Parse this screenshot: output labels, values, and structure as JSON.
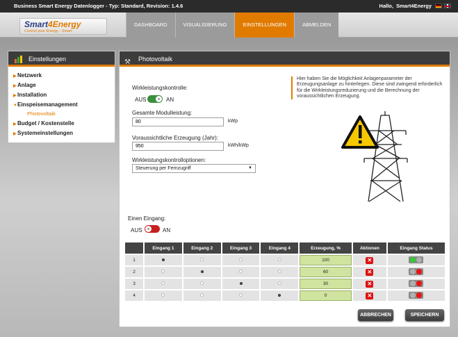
{
  "header": {
    "title": "Business Smart Energy Datenlogger - Typ: Standard, Revision: 1.4.6",
    "greeting": "Hallo,",
    "username": "Smart4Energy",
    "flags": [
      "de-flag-icon",
      "en-flag-icon"
    ]
  },
  "logo": {
    "name_a": "Smart",
    "name_b": "4Energy",
    "tagline": "Control your Energy - Smart"
  },
  "nav": {
    "items": [
      "DASHBOARD",
      "VISUALISIERUNG",
      "EINSTELLUNGEN",
      "ABMELDEN"
    ],
    "active": "EINSTELLUNGEN"
  },
  "sidebar": {
    "title": "Einstellungen",
    "items": [
      {
        "label": "Netzwerk",
        "arrow": "▶"
      },
      {
        "label": "Anlage",
        "arrow": "▶"
      },
      {
        "label": "Installation",
        "arrow": "▶"
      },
      {
        "label": "Einspeisemanagement",
        "arrow": "▼"
      },
      {
        "label": "Photovoltaik",
        "sub": true
      },
      {
        "label": "Budget / Kostenstelle",
        "arrow": "▶"
      },
      {
        "label": "Systemeinstellungen",
        "arrow": "▶"
      }
    ]
  },
  "main": {
    "title": "Photovoltaik",
    "wirk_label": "Wirkleistungskontrolle:",
    "aus": "AUS",
    "an": "AN",
    "wirk_on": true,
    "gesamt_label": "Gesamte Modulleistung:",
    "gesamt_value": "80",
    "gesamt_unit": "kWp",
    "erz_label": "Voraussichtliche Erzeugung (Jahr):",
    "erz_value": "950",
    "erz_unit": "kWh/kWp",
    "opt_label": "Wirkleistungskontrolloptionen:",
    "opt_value": "Steuerung per Fernzugriff",
    "info": "Hier haben Sie die Möglichkeit Anlagenparameter der Erzeugungsanlage zu hinterlegen. Diese sind zwingend erforderlich für die Wirkleistungsreduzierung und die Berechnung der voraussichtlichen Erzeugung.",
    "eingang_label": "Einen Eingang:",
    "eingang_on": false
  },
  "table": {
    "headers": [
      "",
      "Eingang 1",
      "Eingang 2",
      "Eingang 3",
      "Eingang 4",
      "Erzeugung, %",
      "Aktionen",
      "Eingang Status"
    ],
    "rows": [
      {
        "n": "1",
        "sel": 1,
        "value": "100",
        "status": [
          "green",
          "grey"
        ]
      },
      {
        "n": "2",
        "sel": 2,
        "value": "60",
        "status": [
          "grey",
          "red"
        ]
      },
      {
        "n": "3",
        "sel": 3,
        "value": "30",
        "status": [
          "grey",
          "red"
        ]
      },
      {
        "n": "4",
        "sel": 4,
        "value": "0",
        "status": [
          "grey",
          "red"
        ]
      }
    ],
    "delete_glyph": "✕"
  },
  "buttons": {
    "cancel": "ABBRECHEN",
    "save": "SPEICHERN"
  },
  "colors": {
    "accent": "#e07b00",
    "dark": "#3c3c3c",
    "toggle_on": "#3c8f3c",
    "toggle_off": "#c8201e"
  }
}
